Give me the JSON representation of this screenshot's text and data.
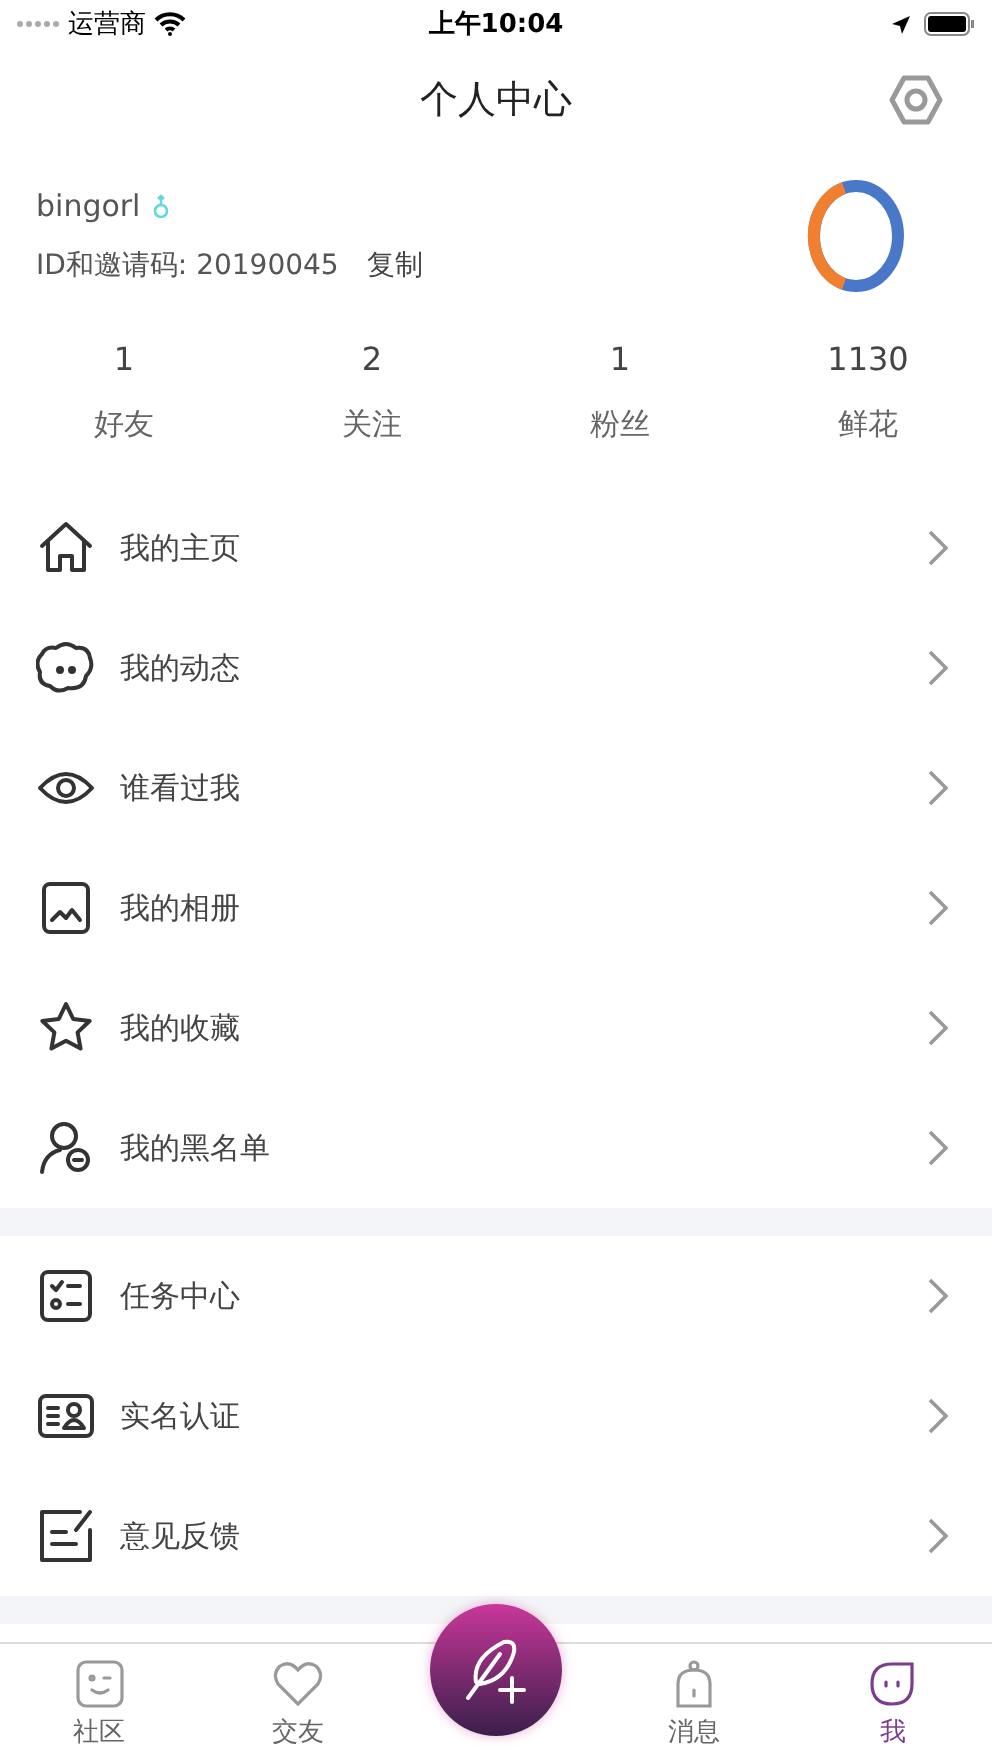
{
  "status_bar": {
    "carrier": "运营商",
    "time": "上午10:04"
  },
  "header": {
    "title": "个人中心"
  },
  "profile": {
    "username": "bingorl",
    "id_label": "ID和邀请码: 20190045",
    "copy": "复制"
  },
  "stats": [
    {
      "value": "1",
      "label": "好友"
    },
    {
      "value": "2",
      "label": "关注"
    },
    {
      "value": "1",
      "label": "粉丝"
    },
    {
      "value": "1130",
      "label": "鲜花"
    }
  ],
  "menu_groups": [
    [
      {
        "kind": "home",
        "label": "我的主页"
      },
      {
        "kind": "moments",
        "label": "我的动态"
      },
      {
        "kind": "visitors",
        "label": "谁看过我"
      },
      {
        "kind": "album",
        "label": "我的相册"
      },
      {
        "kind": "favorites",
        "label": "我的收藏"
      },
      {
        "kind": "blacklist",
        "label": "我的黑名单"
      }
    ],
    [
      {
        "kind": "tasks",
        "label": "任务中心"
      },
      {
        "kind": "verify",
        "label": "实名认证"
      },
      {
        "kind": "feedback",
        "label": "意见反馈"
      }
    ]
  ],
  "tabs": [
    {
      "kind": "community",
      "label": "社区",
      "selected": false
    },
    {
      "kind": "friends",
      "label": "交友",
      "selected": false
    },
    {
      "kind": "compose"
    },
    {
      "kind": "messages",
      "label": "消息",
      "selected": false
    },
    {
      "kind": "me",
      "label": "我",
      "selected": true
    }
  ]
}
